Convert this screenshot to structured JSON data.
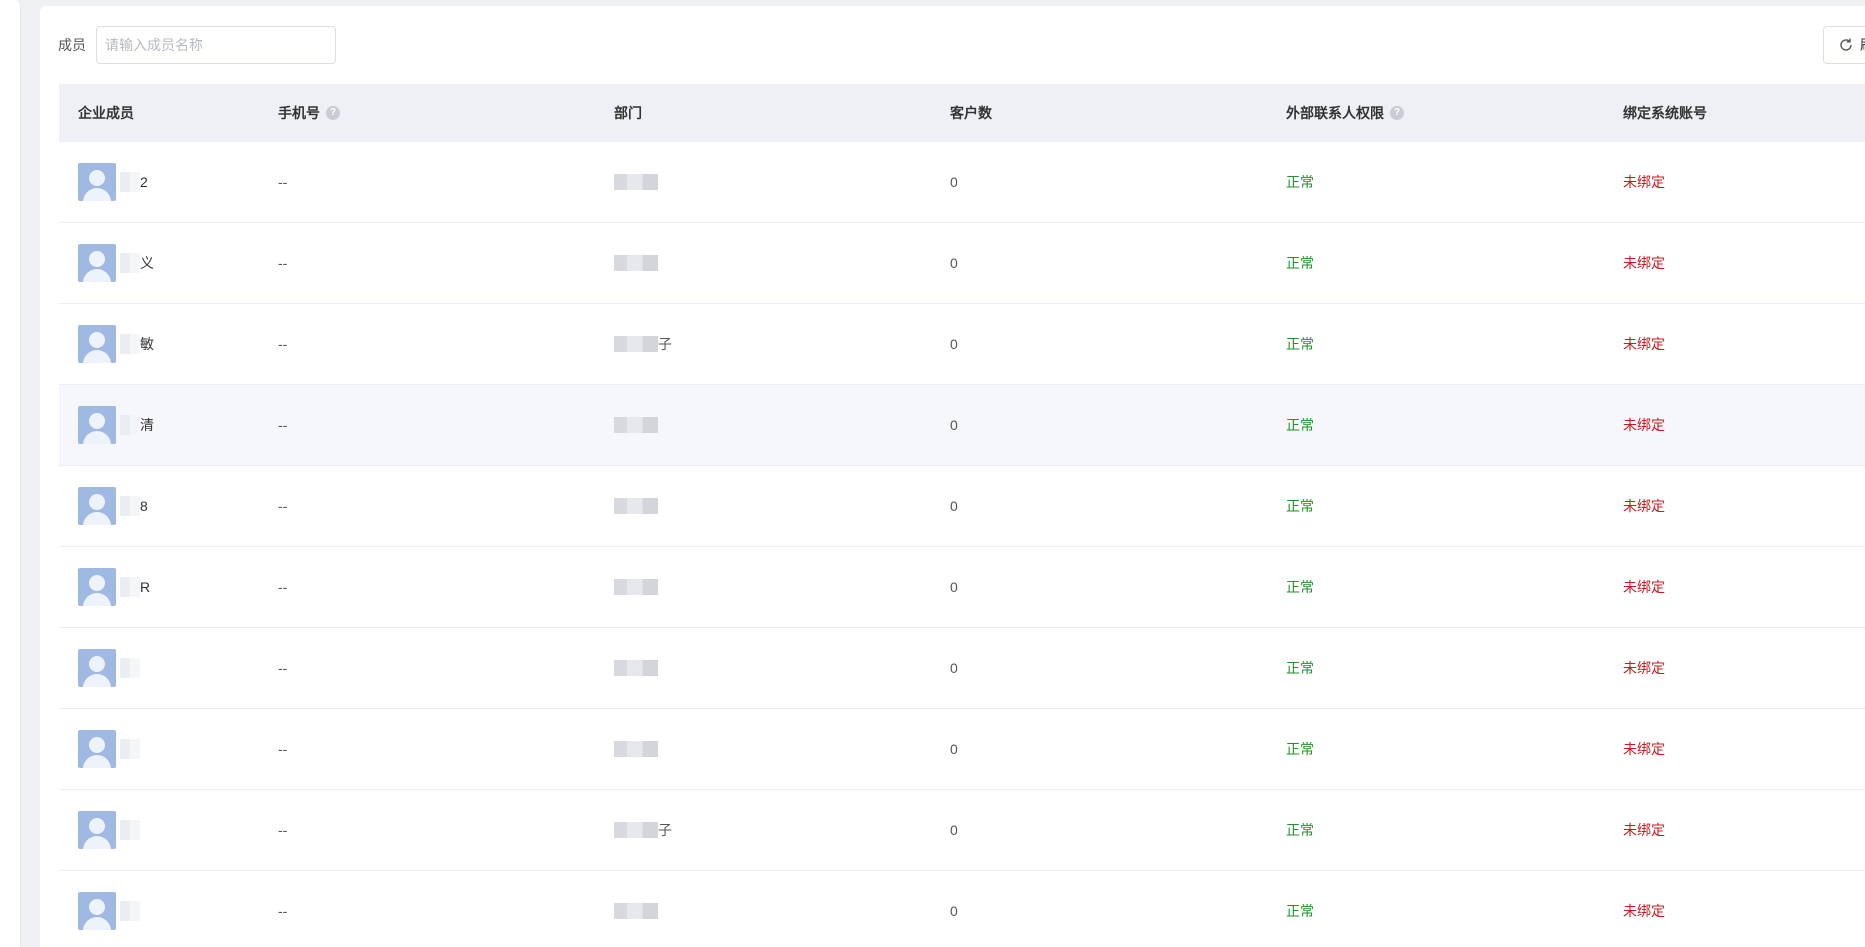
{
  "filter": {
    "label": "成员",
    "placeholder": "请输入成员名称"
  },
  "toolbar": {
    "refresh_label": "刷"
  },
  "table": {
    "columns": [
      {
        "label": "企业成员"
      },
      {
        "label": "手机号",
        "help": "?"
      },
      {
        "label": "部门"
      },
      {
        "label": "客户数"
      },
      {
        "label": "外部联系人权限",
        "help": "?"
      },
      {
        "label": "绑定系统账号"
      }
    ],
    "rows": [
      {
        "name": "2",
        "phone": "--",
        "dept": "",
        "customers": "0",
        "permission": "正常",
        "account": "未绑定"
      },
      {
        "name": "义",
        "phone": "--",
        "dept": "",
        "customers": "0",
        "permission": "正常",
        "account": "未绑定"
      },
      {
        "name": "敏",
        "phone": "--",
        "dept": "子",
        "customers": "0",
        "permission": "正常",
        "account": "未绑定"
      },
      {
        "name": "清",
        "phone": "--",
        "dept": "",
        "customers": "0",
        "permission": "正常",
        "account": "未绑定"
      },
      {
        "name": "8",
        "phone": "--",
        "dept": "",
        "customers": "0",
        "permission": "正常",
        "account": "未绑定"
      },
      {
        "name": "R",
        "phone": "--",
        "dept": "",
        "customers": "0",
        "permission": "正常",
        "account": "未绑定"
      },
      {
        "name": "",
        "phone": "--",
        "dept": "",
        "customers": "0",
        "permission": "正常",
        "account": "未绑定"
      },
      {
        "name": "",
        "phone": "--",
        "dept": "",
        "customers": "0",
        "permission": "正常",
        "account": "未绑定"
      },
      {
        "name": "",
        "phone": "--",
        "dept": "子",
        "customers": "0",
        "permission": "正常",
        "account": "未绑定"
      },
      {
        "name": "",
        "phone": "--",
        "dept": "",
        "customers": "0",
        "permission": "正常",
        "account": "未绑定"
      }
    ]
  },
  "colors": {
    "status_ok": "#21912a",
    "status_unbound": "#c8191f",
    "header_bg": "#eef0f5",
    "avatar_bg": "#9fb9e3"
  }
}
